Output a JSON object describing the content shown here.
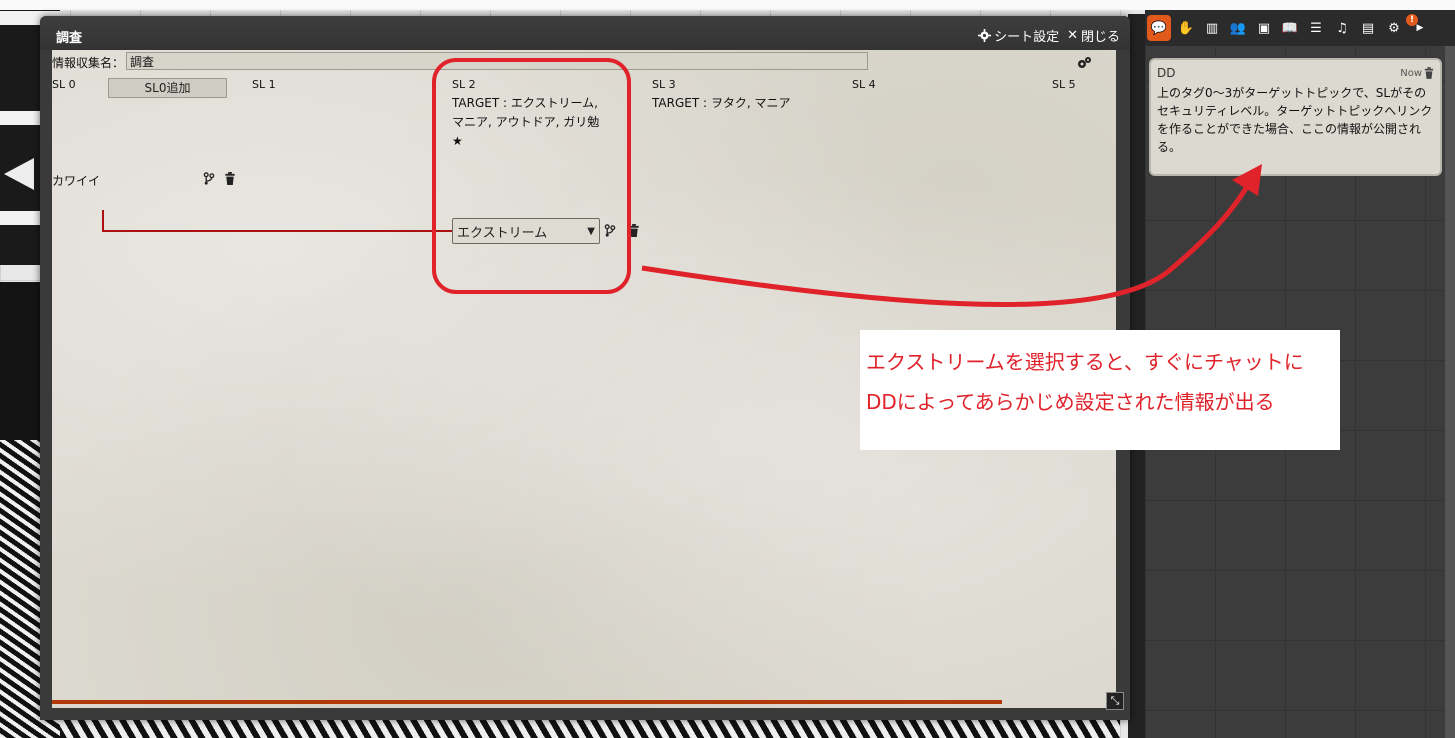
{
  "window": {
    "title": "調査",
    "sheet_settings_label": "シート設定",
    "close_label": "閉じる"
  },
  "sheet": {
    "name_label": "情報収集名：",
    "name_value": "調査",
    "add_sl0_label": "SL0追加",
    "sl_columns": [
      {
        "label": "SL 0",
        "target": ""
      },
      {
        "label": "SL 1",
        "target": ""
      },
      {
        "label": "SL 2",
        "target": "TARGET : エクストリーム, マニア, アウトドア, ガリ勉 ★"
      },
      {
        "label": "SL 3",
        "target": "TARGET : ヲタク, マニア"
      },
      {
        "label": "SL 4",
        "target": ""
      },
      {
        "label": "SL 5",
        "target": ""
      }
    ],
    "topic_name": "カワイイ",
    "link_select_value": "エクストリーム"
  },
  "chat": {
    "tabs": [
      "chat",
      "hand",
      "map",
      "people",
      "bag",
      "book",
      "list",
      "music",
      "journal",
      "settings"
    ],
    "active_tab": "chat",
    "message": {
      "author": "DD",
      "time": "Now",
      "body": "上のタグ0～3がターゲットトピックで、SLがそのセキュリティレベル。ターゲットトピックへリンクを作ることができた場合、ここの情報が公開される。"
    }
  },
  "annotation": {
    "line1": "エクストリームを選択すると、すぐにチャットに",
    "line2": "DDによってあらかじめ設定された情報が出る",
    "color": "#e0222a"
  }
}
